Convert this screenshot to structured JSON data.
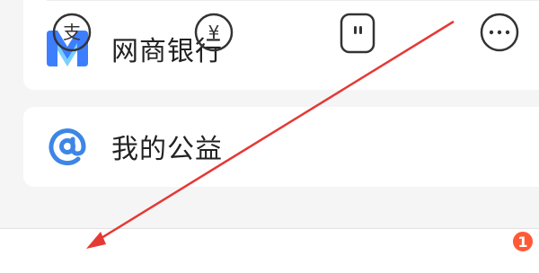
{
  "menu": {
    "items": [
      {
        "label": "网商银行",
        "icon": "mybank-logo-icon",
        "color": "#3d7eff"
      },
      {
        "label": "我的公益",
        "icon": "charity-logo-icon",
        "color": "#3d86e6"
      }
    ]
  },
  "tabbar": {
    "tabs": [
      {
        "icon": "alipay-icon",
        "label_glyph": "支"
      },
      {
        "icon": "wealth-yuan-icon",
        "label_glyph": "¥"
      },
      {
        "icon": "video-icon"
      },
      {
        "icon": "more-icon",
        "badge": "1"
      }
    ]
  },
  "annotation": {
    "arrow_color": "#e53935"
  }
}
